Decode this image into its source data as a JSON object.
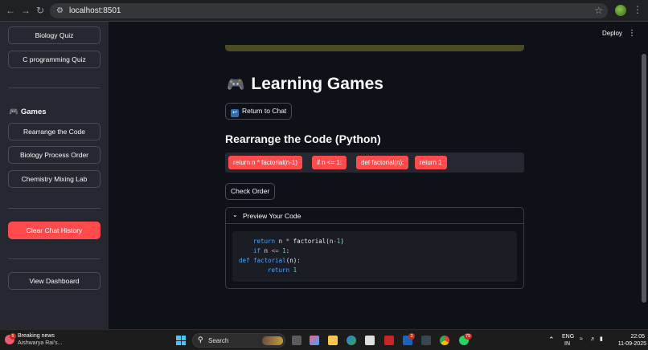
{
  "browser": {
    "url": "localhost:8501"
  },
  "sidebar": {
    "quiz_buttons": [
      "Biology Quiz",
      "C programming Quiz"
    ],
    "games_heading": "Games",
    "game_buttons": [
      "Rearrange the Code",
      "Biology Process Order",
      "Chemistry Mixing Lab"
    ],
    "clear_button": "Clear Chat History",
    "dashboard_button": "View Dashboard"
  },
  "header": {
    "deploy_label": "Deploy"
  },
  "main": {
    "title": "Learning Games",
    "return_button": "Return to Chat",
    "subtitle": "Rearrange the Code (Python)",
    "code_chips": [
      "return n * factorial(n-1)",
      "if n <= 1:",
      "def factorial(n):",
      "return 1"
    ],
    "check_button": "Check Order",
    "preview_label": "Preview Your Code"
  },
  "taskbar": {
    "news_title": "Breaking news",
    "news_subtitle": "Aishwarya Rai's...",
    "news_badge": "5",
    "search_placeholder": "Search",
    "lang_top": "ENG",
    "lang_bottom": "IN",
    "time": "22:05",
    "date": "11-09-2025",
    "badge_a": "3",
    "badge_b": "79"
  },
  "colors": {
    "accent_red": "#ff4b4b",
    "background": "#0e1117",
    "sidebar": "#262730"
  },
  "icons": [
    "back-icon",
    "forward-icon",
    "reload-icon",
    "site-info-icon",
    "star-icon",
    "gamepad-icon",
    "return-icon",
    "chevron-down-icon",
    "windows-icon",
    "search-icon"
  ]
}
